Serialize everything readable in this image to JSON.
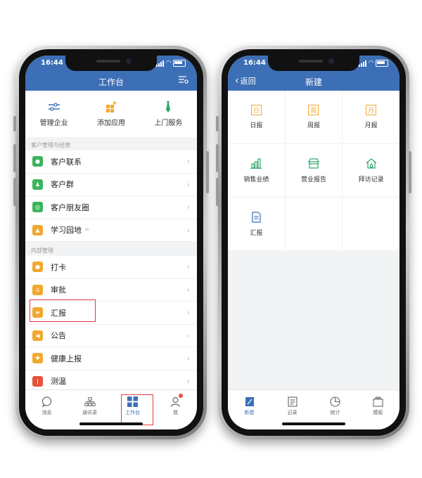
{
  "left": {
    "time": "16:44",
    "title": "工作台",
    "quick": [
      {
        "icon": "sliders-icon",
        "label": "管理企业",
        "color": "#3d6fb6"
      },
      {
        "icon": "add-app-icon",
        "label": "添加应用",
        "color": "#f0a830"
      },
      {
        "icon": "tie-icon",
        "label": "上门服务",
        "color": "#2fa86b"
      }
    ],
    "section1": "客户管理与经营",
    "customer_items": [
      {
        "label": "客户联系",
        "icon": "chat-icon",
        "color": "#3bb55b"
      },
      {
        "label": "客户群",
        "icon": "group-icon",
        "color": "#3bb55b"
      },
      {
        "label": "客户朋友圈",
        "icon": "moments-icon",
        "color": "#3bb55b"
      },
      {
        "label": "学习园地",
        "icon": "cap-icon",
        "color": "#f0a830"
      }
    ],
    "section2": "内部管理",
    "internal_items": [
      {
        "label": "打卡",
        "icon": "location-icon",
        "color": "#f0a830"
      },
      {
        "label": "审批",
        "icon": "stamp-icon",
        "color": "#f0a830"
      },
      {
        "label": "汇报",
        "icon": "report-icon",
        "color": "#f0a830"
      },
      {
        "label": "公告",
        "icon": "megaphone-icon",
        "color": "#f0a830"
      },
      {
        "label": "健康上报",
        "icon": "health-icon",
        "color": "#f0a830"
      },
      {
        "label": "测温",
        "icon": "thermometer-icon",
        "color": "#e4533a"
      }
    ],
    "tabs": [
      {
        "label": "消息",
        "icon": "message-icon"
      },
      {
        "label": "通讯录",
        "icon": "contacts-icon"
      },
      {
        "label": "工作台",
        "icon": "grid-icon"
      },
      {
        "label": "我",
        "icon": "person-icon"
      }
    ]
  },
  "right": {
    "time": "16:44",
    "back": "返回",
    "title": "新建",
    "cells": [
      {
        "label": "日报",
        "icon": "day-report-icon",
        "glyph": "日",
        "color": "#f0a830"
      },
      {
        "label": "周报",
        "icon": "week-report-icon",
        "glyph": "周",
        "color": "#f0a830"
      },
      {
        "label": "月报",
        "icon": "month-report-icon",
        "glyph": "月",
        "color": "#f0a830"
      },
      {
        "label": "销售业绩",
        "icon": "bar-chart-icon",
        "glyph": "",
        "color": "#2fa86b"
      },
      {
        "label": "营业报告",
        "icon": "store-icon",
        "glyph": "",
        "color": "#2fa86b"
      },
      {
        "label": "拜访记录",
        "icon": "house-icon",
        "glyph": "",
        "color": "#2fa86b"
      },
      {
        "label": "汇报",
        "icon": "document-icon",
        "glyph": "",
        "color": "#3d6fb6"
      }
    ],
    "tabs": [
      {
        "label": "新建",
        "icon": "edit-icon"
      },
      {
        "label": "记录",
        "icon": "record-icon"
      },
      {
        "label": "统计",
        "icon": "pie-icon"
      },
      {
        "label": "模板",
        "icon": "template-icon"
      }
    ]
  },
  "colors": {
    "header": "#3d6fb6",
    "highlight": "#e23b3b",
    "active_tab": "#3d6fb6"
  }
}
